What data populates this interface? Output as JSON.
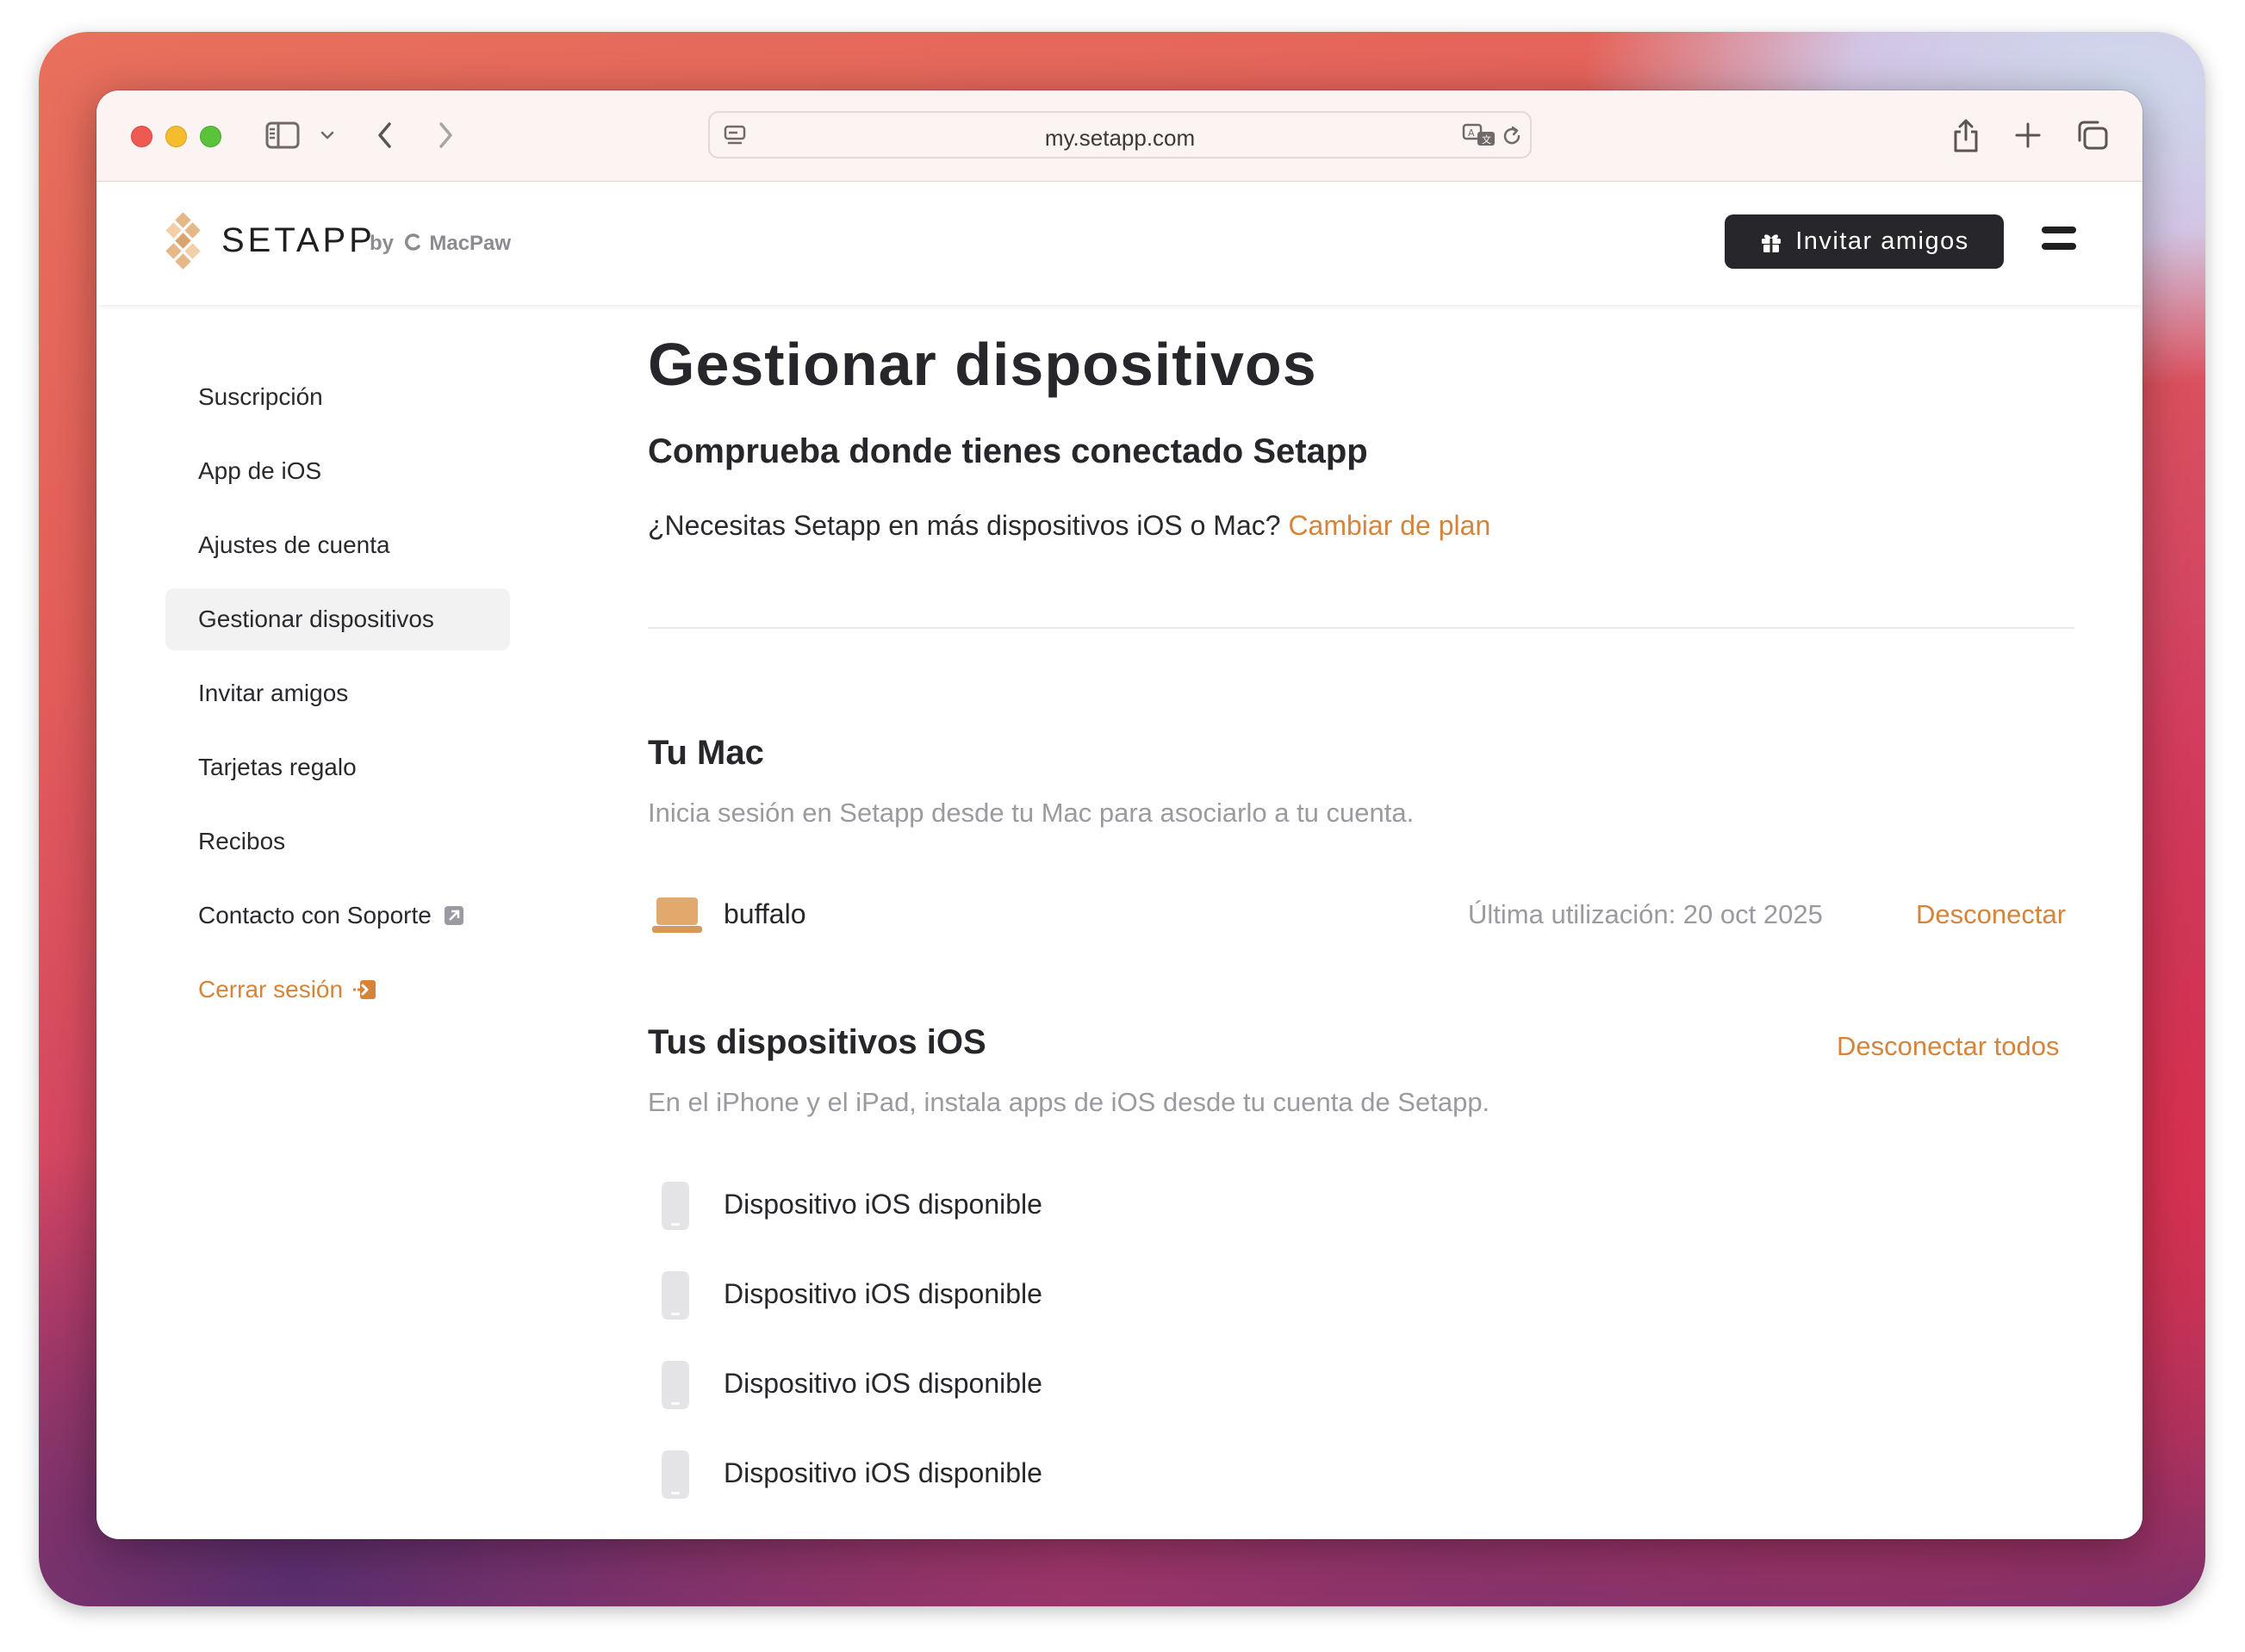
{
  "browser": {
    "url": "my.setapp.com"
  },
  "header": {
    "brand": "SETAPP",
    "brand_by": "by",
    "brand_company": "MacPaw",
    "invite_label": "Invitar amigos"
  },
  "sidebar": {
    "items": [
      {
        "label": "Suscripción"
      },
      {
        "label": "App de iOS"
      },
      {
        "label": "Ajustes de cuenta"
      },
      {
        "label": "Gestionar dispositivos",
        "active": true
      },
      {
        "label": "Invitar amigos"
      },
      {
        "label": "Tarjetas regalo"
      },
      {
        "label": "Recibos"
      },
      {
        "label": "Contacto con Soporte"
      }
    ],
    "logout_label": "Cerrar sesión"
  },
  "main": {
    "title": "Gestionar dispositivos",
    "subtitle": "Comprueba donde tienes conectado Setapp",
    "upgrade_text": "¿Necesitas Setapp en más dispositivos iOS o Mac?",
    "upgrade_link": "Cambiar de plan",
    "mac_section": {
      "title": "Tu Mac",
      "description": "Inicia sesión en Setapp desde tu Mac para asociarlo a tu cuenta.",
      "device": {
        "name": "buffalo",
        "last_used": "Última utilización: 20 oct 2025",
        "action": "Desconectar"
      }
    },
    "ios_section": {
      "title": "Tus dispositivos iOS",
      "disconnect_all": "Desconectar todos",
      "description": "En el iPhone y el iPad, instala apps de iOS desde tu cuenta de Setapp.",
      "devices": [
        {
          "name": "Dispositivo iOS disponible"
        },
        {
          "name": "Dispositivo iOS disponible"
        },
        {
          "name": "Dispositivo iOS disponible"
        },
        {
          "name": "Dispositivo iOS disponible"
        }
      ]
    }
  },
  "colors": {
    "accent": "#d5843a",
    "dark_button": "#26262b",
    "mac_icon": "#e2a86c"
  }
}
